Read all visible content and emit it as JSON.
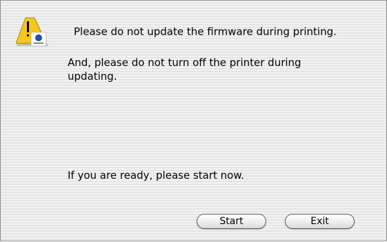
{
  "dialog": {
    "icon": "caution-triangle-icon",
    "message_1": "Please do not update the firmware during printing.",
    "message_2": "And, please do not turn off the printer during\nupdating.",
    "message_3": "If you are ready, please start now.",
    "start_label": "Start",
    "exit_label": "Exit"
  },
  "colors": {
    "caution_yellow": "#f5c81a",
    "logo_blue": "#1a4fb0"
  }
}
